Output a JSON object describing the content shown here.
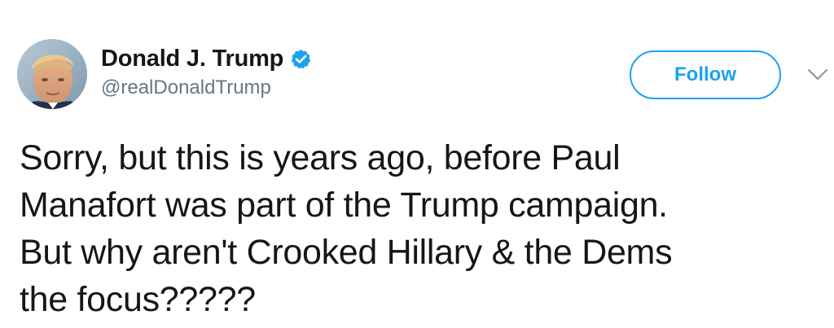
{
  "author": {
    "display_name": "Donald J. Trump",
    "handle": "@realDonaldTrump",
    "verified": true
  },
  "actions": {
    "follow_label": "Follow"
  },
  "tweet": {
    "lines": [
      "Sorry, but this is years ago, before Paul",
      "Manafort was part of the Trump campaign.",
      "But why aren't Crooked Hillary & the Dems",
      "the focus?????"
    ]
  },
  "colors": {
    "accent": "#1da1f2",
    "text": "#14171a",
    "secondary_text": "#657786",
    "background": "#ffffff"
  },
  "icons": {
    "verified": "verified-badge-icon",
    "menu": "chevron-down-icon"
  }
}
